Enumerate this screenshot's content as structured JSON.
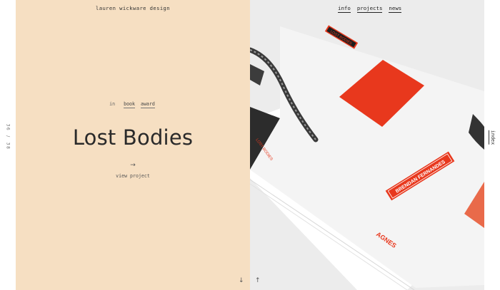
{
  "brand": "lauren wickware design",
  "counter": {
    "current": "36",
    "separator": "/",
    "total": "38"
  },
  "project": {
    "in_label": "in",
    "tags": [
      "book",
      "award"
    ],
    "title": "Lost Bodies",
    "arrow": "→",
    "view_label": "view project"
  },
  "nav": {
    "items": [
      "info",
      "projects",
      "news"
    ]
  },
  "side_label": "index",
  "scroll": {
    "down": "↓",
    "up": "↑"
  },
  "book": {
    "label_tag": "LOST BODIES",
    "author": "BRENDAN FERNANDES",
    "publisher": "AGNES",
    "spine_title": "LOST BODIES"
  },
  "colors": {
    "panel_bg": "#f6dfc2",
    "accent": "#e8381d",
    "ink": "#2a2a2a",
    "cover": "#f4f4f4",
    "spine": "#2c2c2c"
  }
}
